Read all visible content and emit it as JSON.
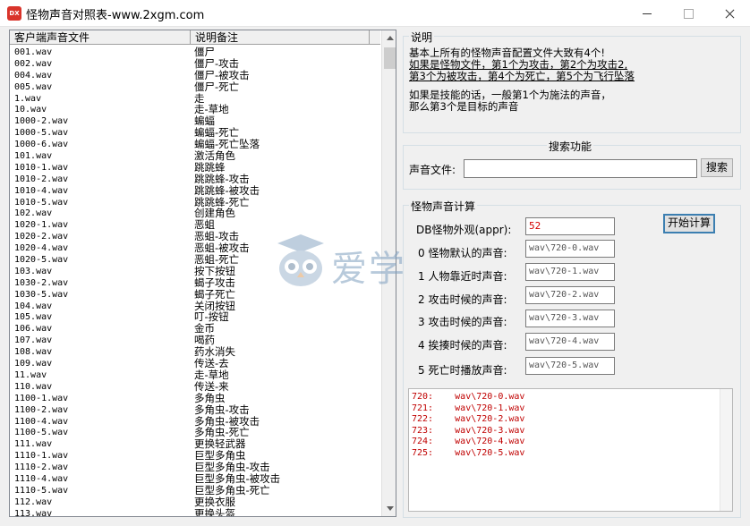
{
  "window": {
    "title": "怪物声音对照表-www.2xgm.com",
    "icon_text": "DX"
  },
  "list": {
    "columns": [
      "客户端声音文件",
      "说明备注"
    ],
    "rows": [
      {
        "file": "001.wav",
        "desc": "僵尸"
      },
      {
        "file": "002.wav",
        "desc": "僵尸-攻击"
      },
      {
        "file": "004.wav",
        "desc": "僵尸-被攻击"
      },
      {
        "file": "005.wav",
        "desc": "僵尸-死亡"
      },
      {
        "file": "1.wav",
        "desc": "走"
      },
      {
        "file": "10.wav",
        "desc": "走-草地"
      },
      {
        "file": "1000-2.wav",
        "desc": "蝙蝠"
      },
      {
        "file": "1000-5.wav",
        "desc": "蝙蝠-死亡"
      },
      {
        "file": "1000-6.wav",
        "desc": "蝙蝠-死亡坠落"
      },
      {
        "file": "101.wav",
        "desc": "激活角色"
      },
      {
        "file": "1010-1.wav",
        "desc": "跳跳蜂"
      },
      {
        "file": "1010-2.wav",
        "desc": "跳跳蜂-攻击"
      },
      {
        "file": "1010-4.wav",
        "desc": "跳跳蜂-被攻击"
      },
      {
        "file": "1010-5.wav",
        "desc": "跳跳蜂-死亡"
      },
      {
        "file": "102.wav",
        "desc": "创建角色"
      },
      {
        "file": "1020-1.wav",
        "desc": "恶蛆"
      },
      {
        "file": "1020-2.wav",
        "desc": "恶蛆-攻击"
      },
      {
        "file": "1020-4.wav",
        "desc": "恶蛆-被攻击"
      },
      {
        "file": "1020-5.wav",
        "desc": "恶蛆-死亡"
      },
      {
        "file": "103.wav",
        "desc": "按下按钮"
      },
      {
        "file": "1030-2.wav",
        "desc": "蝎子攻击"
      },
      {
        "file": "1030-5.wav",
        "desc": "蝎子死亡"
      },
      {
        "file": "104.wav",
        "desc": "关闭按钮"
      },
      {
        "file": "105.wav",
        "desc": "叮-按钮"
      },
      {
        "file": "106.wav",
        "desc": "金币"
      },
      {
        "file": "107.wav",
        "desc": "喝药"
      },
      {
        "file": "108.wav",
        "desc": "药水消失"
      },
      {
        "file": "109.wav",
        "desc": "传送-去"
      },
      {
        "file": "11.wav",
        "desc": "走-草地"
      },
      {
        "file": "110.wav",
        "desc": "传送-来"
      },
      {
        "file": "1100-1.wav",
        "desc": "多角虫"
      },
      {
        "file": "1100-2.wav",
        "desc": "多角虫-攻击"
      },
      {
        "file": "1100-4.wav",
        "desc": "多角虫-被攻击"
      },
      {
        "file": "1100-5.wav",
        "desc": "多角虫-死亡"
      },
      {
        "file": "111.wav",
        "desc": "更换轻武器"
      },
      {
        "file": "1110-1.wav",
        "desc": "巨型多角虫"
      },
      {
        "file": "1110-2.wav",
        "desc": "巨型多角虫-攻击"
      },
      {
        "file": "1110-4.wav",
        "desc": "巨型多角虫-被攻击"
      },
      {
        "file": "1110-5.wav",
        "desc": "巨型多角虫-死亡"
      },
      {
        "file": "112.wav",
        "desc": "更换衣服"
      },
      {
        "file": "113.wav",
        "desc": "更换头盔"
      }
    ]
  },
  "explain": {
    "title": "说明",
    "lines": [
      "基本上所有的怪物声音配置文件大致有4个!",
      "如果是怪物文件，第1个为攻击，第2个为攻击2,",
      "第3个为被攻击，第4个为死亡，第5个为飞行坠落",
      "如果是技能的话，一般第1个为施法的声音，",
      "那么第3个是目标的声音"
    ]
  },
  "search": {
    "title": "搜索功能",
    "label": "声音文件:",
    "value": "",
    "button": "搜索"
  },
  "calc": {
    "title": "怪物声音计算",
    "appr_label": "DB怪物外观(appr):",
    "appr_value": "52",
    "button": "开始计算",
    "fields": [
      {
        "label": "0 怪物默认的声音:",
        "value": "wav\\720-0.wav"
      },
      {
        "label": "1 人物靠近时声音:",
        "value": "wav\\720-1.wav"
      },
      {
        "label": "2 攻击时候的声音:",
        "value": "wav\\720-2.wav"
      },
      {
        "label": "3 攻击时候的声音:",
        "value": "wav\\720-3.wav"
      },
      {
        "label": "4 挨揍时候的声音:",
        "value": "wav\\720-4.wav"
      },
      {
        "label": "5 死亡时播放声音:",
        "value": "wav\\720-5.wav"
      }
    ],
    "output": [
      "720:    wav\\720-0.wav",
      "721:    wav\\720-1.wav",
      "722:    wav\\720-2.wav",
      "723:    wav\\720-3.wav",
      "724:    wav\\720-4.wav",
      "725:    wav\\720-5.wav"
    ]
  },
  "watermark": {
    "text": "爱学"
  },
  "colors": {
    "output_text": "#c00000",
    "button_border": "#3c7fb1"
  }
}
